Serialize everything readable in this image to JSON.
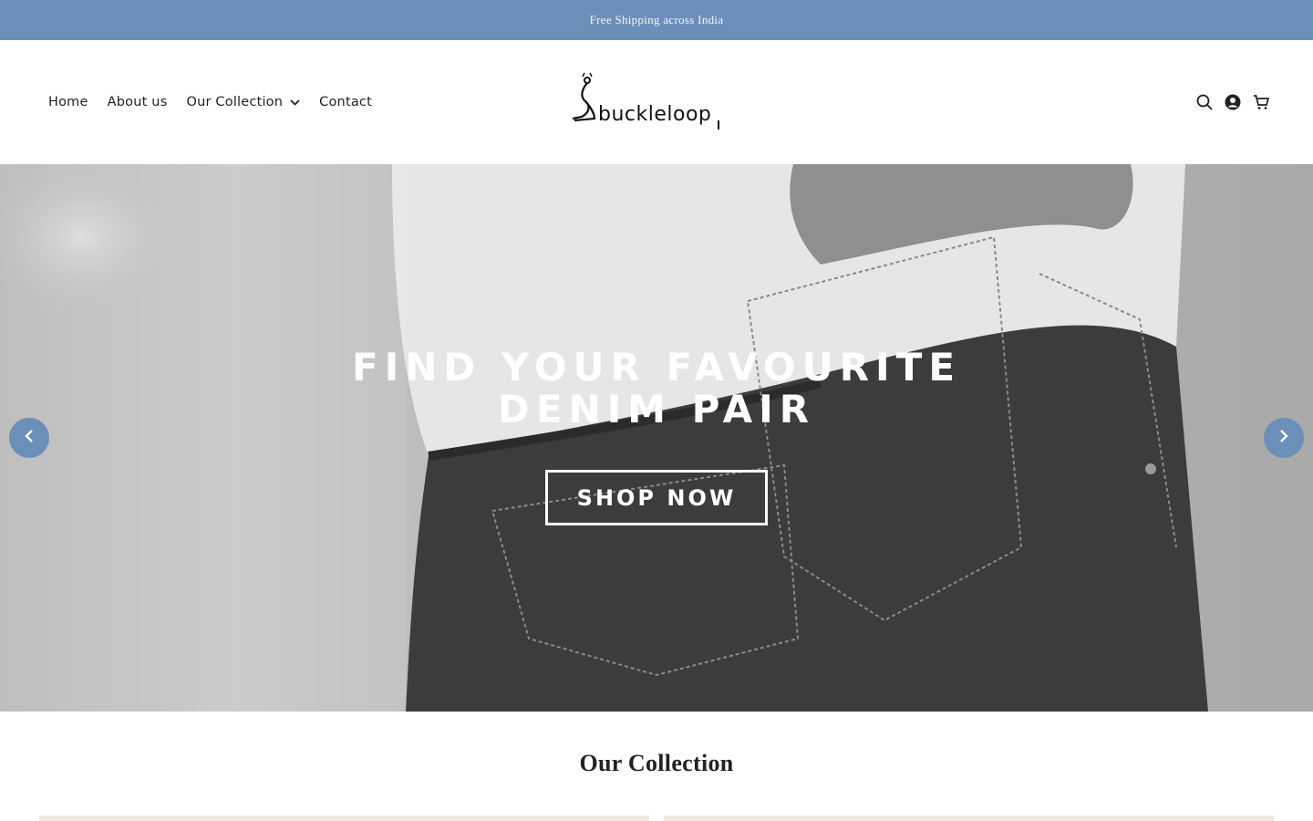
{
  "announcement": {
    "text": "Free Shipping across India"
  },
  "header": {
    "nav": [
      {
        "label": "Home"
      },
      {
        "label": "About us"
      },
      {
        "label": "Our Collection",
        "has_dropdown": true
      },
      {
        "label": "Contact"
      }
    ],
    "logo_text": "buckleloop",
    "icons": [
      "search-icon",
      "account-icon",
      "cart-icon"
    ]
  },
  "hero": {
    "title_line1": "FIND YOUR FAVOURITE",
    "title_line2": "DENIM PAIR",
    "cta_label": "SHOP NOW",
    "prev_icon": "chevron-left-icon",
    "next_icon": "chevron-right-icon"
  },
  "collection": {
    "heading": "Our Collection"
  },
  "colors": {
    "accent": "#6b8fb9",
    "text": "#222222",
    "background": "#ffffff"
  }
}
